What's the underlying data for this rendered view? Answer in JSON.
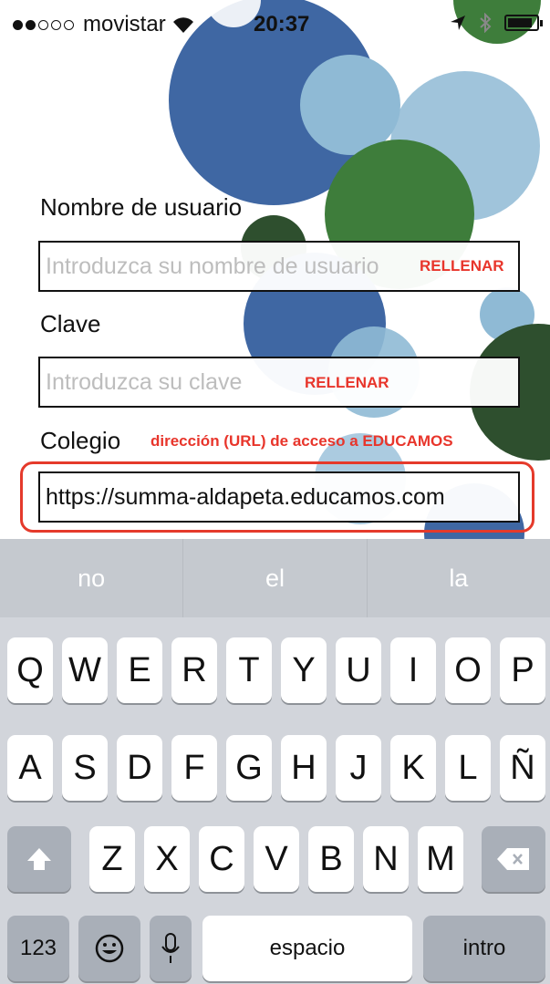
{
  "status_bar": {
    "carrier": "movistar",
    "time": "20:37",
    "signal_strength": "2 of 5",
    "icons": [
      "wifi-icon",
      "location-arrow-icon",
      "bluetooth-icon",
      "battery-icon"
    ]
  },
  "form": {
    "username": {
      "label": "Nombre de usuario",
      "placeholder": "Introduzca su nombre de usuario",
      "note": "RELLENAR"
    },
    "password": {
      "label": "Clave",
      "placeholder": "Introduzca su clave",
      "note": "RELLENAR"
    },
    "school": {
      "label": "Colegio",
      "note": "dirección (URL) de acceso a EDUCAMOS",
      "value": "https://summa-aldapeta.educamos.com"
    },
    "highlight_color": "#e53a2b",
    "note_color": "#e8352b"
  },
  "keyboard": {
    "suggestions": [
      "no",
      "el",
      "la"
    ],
    "row1": [
      "Q",
      "W",
      "E",
      "R",
      "T",
      "Y",
      "U",
      "I",
      "O",
      "P"
    ],
    "row2": [
      "A",
      "S",
      "D",
      "F",
      "G",
      "H",
      "J",
      "K",
      "L",
      "Ñ"
    ],
    "row3": [
      "Z",
      "X",
      "C",
      "V",
      "B",
      "N",
      "M"
    ],
    "numbers_label": "123",
    "space_label": "espacio",
    "return_label": "intro",
    "icons": {
      "shift": "shift-icon",
      "backspace": "backspace-icon",
      "emoji": "emoji-icon",
      "mic": "microphone-icon"
    }
  },
  "colors": {
    "blue": "#3f67a3",
    "light_blue": "#8fbad5",
    "green": "#3e7d3b",
    "dark_green": "#2e4f2e"
  }
}
